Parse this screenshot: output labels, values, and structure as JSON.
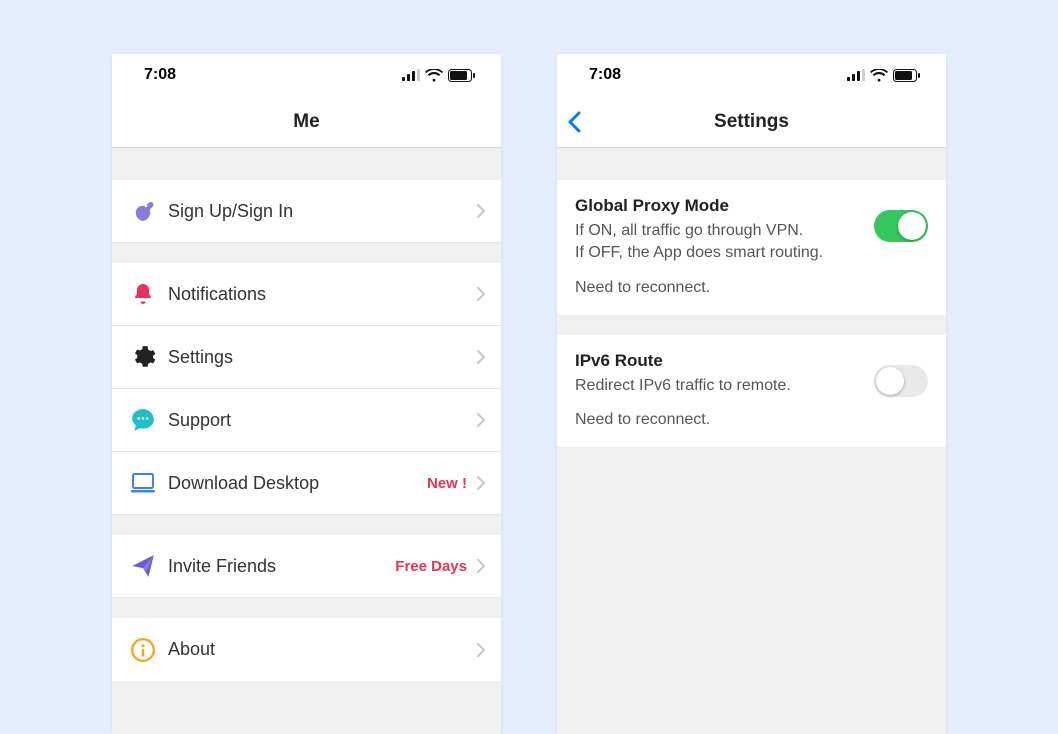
{
  "status": {
    "time": "7:08"
  },
  "left": {
    "title": "Me",
    "sign_in": "Sign Up/Sign In",
    "notifications": "Notifications",
    "settings": "Settings",
    "support": "Support",
    "download_desktop": "Download Desktop",
    "download_badge": "New !",
    "invite_friends": "Invite Friends",
    "invite_badge": "Free Days",
    "about": "About"
  },
  "right": {
    "title": "Settings",
    "proxy": {
      "title": "Global Proxy Mode",
      "line1": "If ON,  all traffic go through VPN.",
      "line2": "If OFF, the App does smart routing.",
      "note": "Need to reconnect.",
      "on": true
    },
    "ipv6": {
      "title": "IPv6 Route",
      "desc": "Redirect IPv6 traffic to remote.",
      "note": "Need to reconnect.",
      "on": false
    }
  }
}
